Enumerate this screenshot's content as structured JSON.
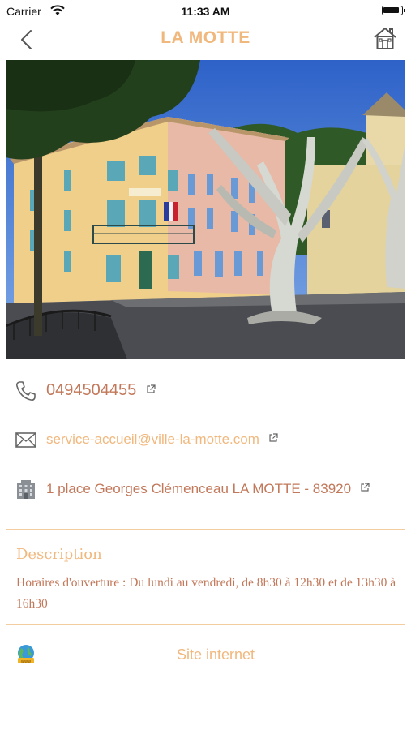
{
  "status_bar": {
    "carrier": "Carrier",
    "time": "11:33 AM"
  },
  "nav": {
    "title": "LA MOTTE"
  },
  "contact": {
    "phone": "0494504455",
    "email": "service-accueil@ville-la-motte.com",
    "address": "1 place Georges Clémenceau LA MOTTE - 83920"
  },
  "description": {
    "title": "Description",
    "text": "Horaires d'ouverture : Du lundi au vendredi, de 8h30 à 12h30 et de 13h30 à 16h30"
  },
  "website": {
    "label": "Site internet"
  },
  "colors": {
    "accent": "#f1b87e",
    "text": "#c2785a",
    "divider": "#f3cd9f"
  }
}
